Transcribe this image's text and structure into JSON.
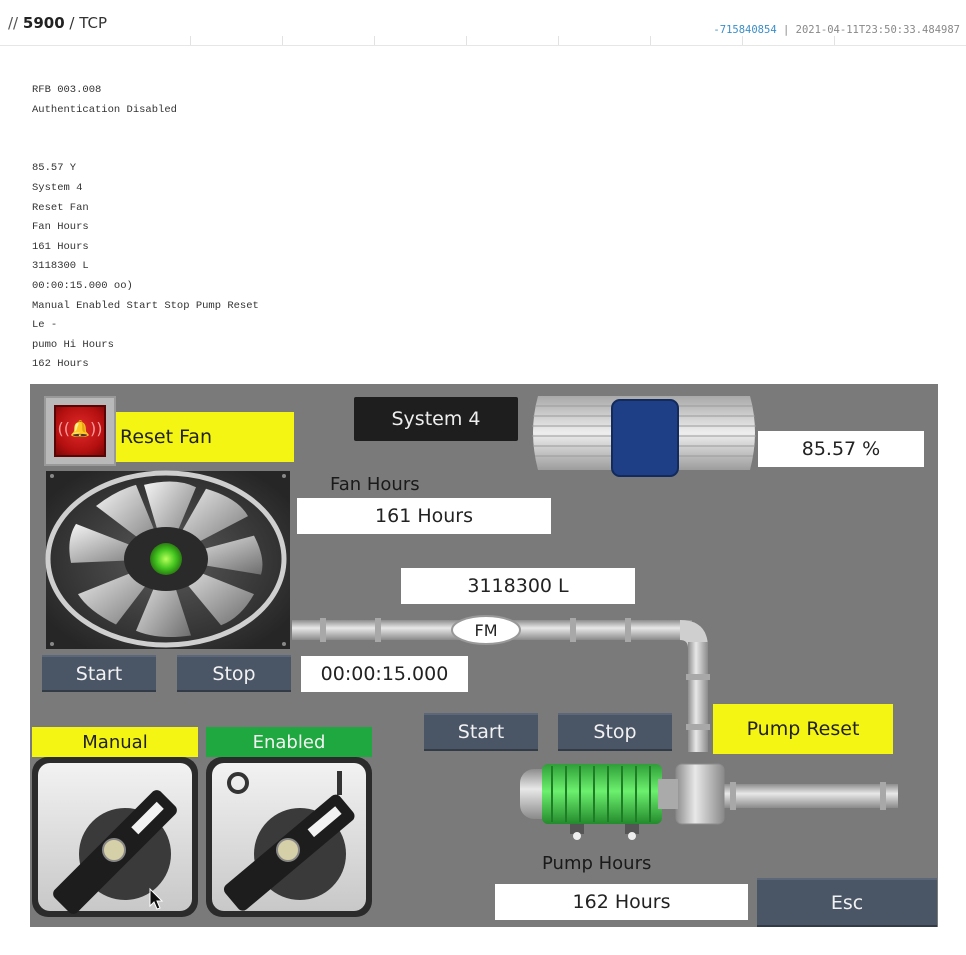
{
  "header": {
    "slashes": "//",
    "port": "5900",
    "protocol": "/ TCP",
    "id": "-715840854",
    "separator": "|",
    "timestamp": "2021-04-11T23:50:33.484987"
  },
  "banner": {
    "lines": [
      "RFB 003.008",
      "Authentication Disabled",
      "",
      "",
      "85.57 Y",
      "System 4",
      "Reset Fan",
      "Fan Hours",
      "161 Hours",
      "3118300 L",
      "00:00:15.000 oo)",
      "Manual Enabled Start Stop Pump Reset",
      "Le -",
      "pumo Hi Hours",
      "162 Hours"
    ]
  },
  "hmi": {
    "system_label": "System 4",
    "reset_fan_label": "Reset Fan",
    "fan_hours_label": "Fan Hours",
    "fan_hours_value": "161 Hours",
    "flow_value": "3118300 L",
    "flow_meter_label": "FM",
    "timer_value": "00:00:15.000",
    "fan_start_label": "Start",
    "fan_stop_label": "Stop",
    "pump_start_label": "Start",
    "pump_stop_label": "Stop",
    "pump_reset_label": "Pump Reset",
    "pump_hours_label": "Pump Hours",
    "pump_hours_value": "162 Hours",
    "esc_label": "Esc",
    "tank_percent": "85.57 %",
    "manual_label": "Manual",
    "enabled_label": "Enabled",
    "switch_off_mark": "O",
    "switch_on_mark": "I",
    "alarm_icon": "alarm-bell-icon"
  },
  "colors": {
    "panel_bg": "#7a7a7a",
    "button_bg": "#4a5566",
    "yellow": "#f5f514",
    "enabled_green": "#20a840",
    "alarm_red": "#c41616",
    "motor_green": "#3fd44a",
    "tank_blue": "#1e3f86"
  }
}
